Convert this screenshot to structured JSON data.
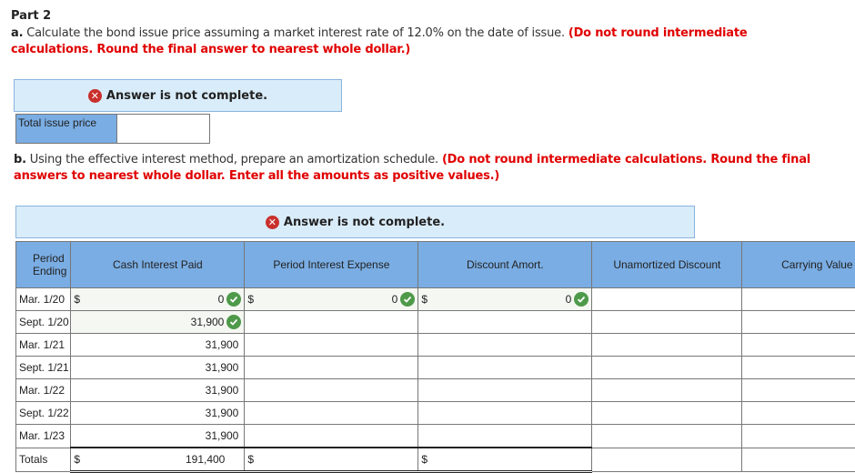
{
  "part_title": "Part 2",
  "part_a": {
    "label": "a.",
    "text": " Calculate the bond issue price assuming a market interest rate of 12.0% on the date of issue. ",
    "note": "(Do not round intermediate calculations. Round the final answer to nearest whole dollar.)",
    "banner": {
      "icon": "x-circle-icon",
      "text": "Answer is not complete."
    },
    "total_issue_price": {
      "label": "Total issue price",
      "value": ""
    }
  },
  "part_b": {
    "label": "b.",
    "text": " Using the effective interest method, prepare an amortization schedule. ",
    "note": "(Do not round intermediate calculations. Round the final answers to nearest whole dollar. Enter all the amounts as positive values.)",
    "banner": {
      "icon": "x-circle-icon",
      "text": "Answer is not complete."
    }
  },
  "schedule": {
    "headers": [
      "Period Ending",
      "Cash Interest Paid",
      "Period Interest Expense",
      "Discount Amort.",
      "Unamortized Discount",
      "Carrying Value"
    ],
    "rows": [
      {
        "period": "Mar. 1/20",
        "cash": "0",
        "expense": "0",
        "amort": "0",
        "unamortized": "",
        "carrying": "",
        "checks": [
          true,
          true,
          true
        ]
      },
      {
        "period": "Sept. 1/20",
        "cash": "31,900",
        "expense": "",
        "amort": "",
        "unamortized": "",
        "carrying": "",
        "checks": [
          true,
          false,
          false
        ]
      },
      {
        "period": "Mar. 1/21",
        "cash": "31,900",
        "expense": "",
        "amort": "",
        "unamortized": "",
        "carrying": ""
      },
      {
        "period": "Sept. 1/21",
        "cash": "31,900",
        "expense": "",
        "amort": "",
        "unamortized": "",
        "carrying": ""
      },
      {
        "period": "Mar. 1/22",
        "cash": "31,900",
        "expense": "",
        "amort": "",
        "unamortized": "",
        "carrying": ""
      },
      {
        "period": "Sept. 1/22",
        "cash": "31,900",
        "expense": "",
        "amort": "",
        "unamortized": "",
        "carrying": ""
      },
      {
        "period": "Mar. 1/23",
        "cash": "31,900",
        "expense": "",
        "amort": "",
        "unamortized": "",
        "carrying": ""
      }
    ],
    "totals": {
      "label": "Totals",
      "cash": "191,400",
      "expense": "",
      "amort": ""
    },
    "currency": "$",
    "colors": {
      "header_bg": "#7aade3",
      "banner_bg": "#d9ecf9",
      "check": "#4e9a4a",
      "error": "#c9302c",
      "note_red": "#e00000"
    }
  }
}
